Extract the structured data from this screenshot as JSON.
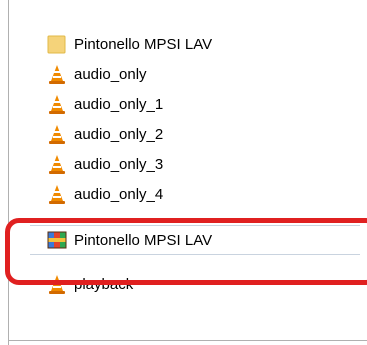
{
  "file_list": {
    "items": [
      {
        "label": "Pintonello MPSI LAV",
        "icon": "folder-icon"
      },
      {
        "label": "audio_only",
        "icon": "vlc-icon"
      },
      {
        "label": "audio_only_1",
        "icon": "vlc-icon"
      },
      {
        "label": "audio_only_2",
        "icon": "vlc-icon"
      },
      {
        "label": "audio_only_3",
        "icon": "vlc-icon"
      },
      {
        "label": "audio_only_4",
        "icon": "vlc-icon"
      },
      {
        "label": "Pintonello MPSI LAV",
        "icon": "archive-icon"
      },
      {
        "label": "playback",
        "icon": "vlc-icon"
      }
    ]
  },
  "colors": {
    "highlight": "#e02020",
    "vlc_orange": "#f08a00",
    "folder": "#f3c24f"
  }
}
